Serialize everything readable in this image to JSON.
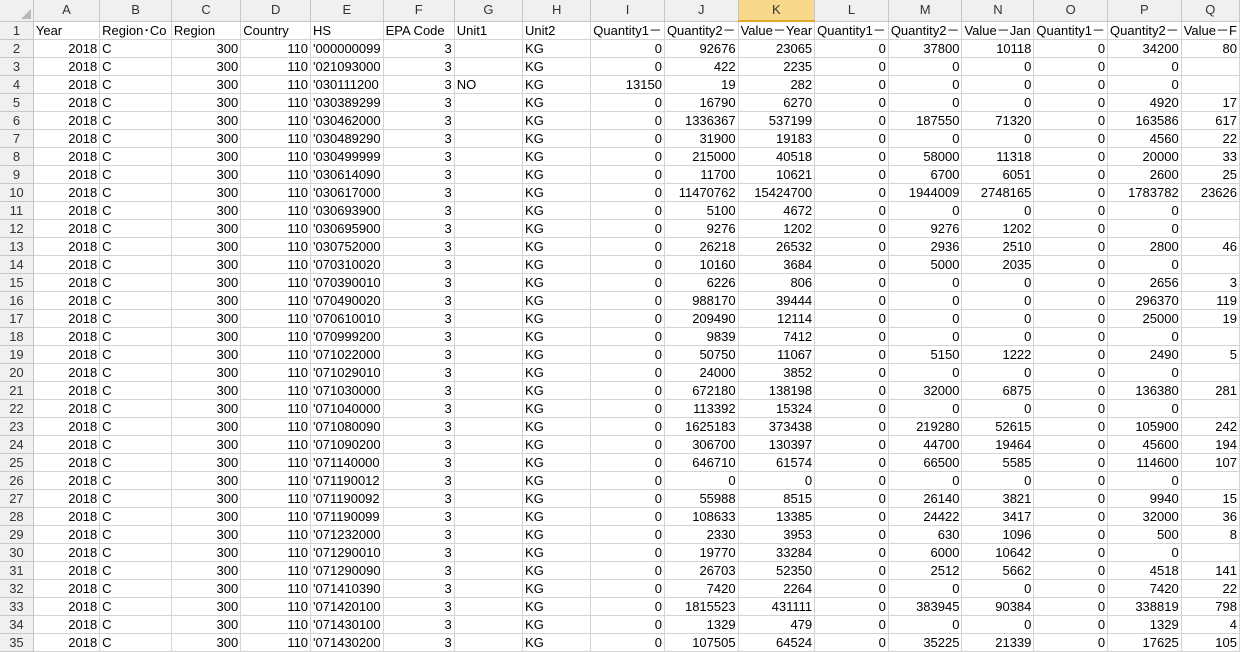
{
  "columns": [
    "A",
    "B",
    "C",
    "D",
    "E",
    "F",
    "G",
    "H",
    "I",
    "J",
    "K",
    "L",
    "M",
    "N",
    "O",
    "P",
    "Q"
  ],
  "selected_column": "K",
  "header_row": {
    "num": 1,
    "cells": [
      "Year",
      "Region･Co",
      "Region",
      "Country",
      "HS",
      "EPA Code",
      "Unit1",
      "Unit2",
      "Quantity1－",
      "Quantity2－",
      "Value－Year",
      "Quantity1－",
      "Quantity2－",
      "Value－Jan",
      "Quantity1－",
      "Quantity2－",
      "Value－F"
    ]
  },
  "rows": [
    {
      "num": 2,
      "hs": "'000000099",
      "unit1": "",
      "q1y": "0",
      "q2y": "92676",
      "vy": "23065",
      "q1j": "0",
      "q2j": "37800",
      "vj": "10118",
      "q1f": "0",
      "q2f": "34200",
      "vf": "80"
    },
    {
      "num": 3,
      "hs": "'021093000",
      "unit1": "",
      "q1y": "0",
      "q2y": "422",
      "vy": "2235",
      "q1j": "0",
      "q2j": "0",
      "vj": "0",
      "q1f": "0",
      "q2f": "0",
      "vf": ""
    },
    {
      "num": 4,
      "hs": "'030111200",
      "unit1": "NO",
      "q1y": "13150",
      "q2y": "19",
      "vy": "282",
      "q1j": "0",
      "q2j": "0",
      "vj": "0",
      "q1f": "0",
      "q2f": "0",
      "vf": ""
    },
    {
      "num": 5,
      "hs": "'030389299",
      "unit1": "",
      "q1y": "0",
      "q2y": "16790",
      "vy": "6270",
      "q1j": "0",
      "q2j": "0",
      "vj": "0",
      "q1f": "0",
      "q2f": "4920",
      "vf": "17"
    },
    {
      "num": 6,
      "hs": "'030462000",
      "unit1": "",
      "q1y": "0",
      "q2y": "1336367",
      "vy": "537199",
      "q1j": "0",
      "q2j": "187550",
      "vj": "71320",
      "q1f": "0",
      "q2f": "163586",
      "vf": "617"
    },
    {
      "num": 7,
      "hs": "'030489290",
      "unit1": "",
      "q1y": "0",
      "q2y": "31900",
      "vy": "19183",
      "q1j": "0",
      "q2j": "0",
      "vj": "0",
      "q1f": "0",
      "q2f": "4560",
      "vf": "22"
    },
    {
      "num": 8,
      "hs": "'030499999",
      "unit1": "",
      "q1y": "0",
      "q2y": "215000",
      "vy": "40518",
      "q1j": "0",
      "q2j": "58000",
      "vj": "11318",
      "q1f": "0",
      "q2f": "20000",
      "vf": "33"
    },
    {
      "num": 9,
      "hs": "'030614090",
      "unit1": "",
      "q1y": "0",
      "q2y": "11700",
      "vy": "10621",
      "q1j": "0",
      "q2j": "6700",
      "vj": "6051",
      "q1f": "0",
      "q2f": "2600",
      "vf": "25"
    },
    {
      "num": 10,
      "hs": "'030617000",
      "unit1": "",
      "q1y": "0",
      "q2y": "11470762",
      "vy": "15424700",
      "q1j": "0",
      "q2j": "1944009",
      "vj": "2748165",
      "q1f": "0",
      "q2f": "1783782",
      "vf": "23626"
    },
    {
      "num": 11,
      "hs": "'030693900",
      "unit1": "",
      "q1y": "0",
      "q2y": "5100",
      "vy": "4672",
      "q1j": "0",
      "q2j": "0",
      "vj": "0",
      "q1f": "0",
      "q2f": "0",
      "vf": ""
    },
    {
      "num": 12,
      "hs": "'030695900",
      "unit1": "",
      "q1y": "0",
      "q2y": "9276",
      "vy": "1202",
      "q1j": "0",
      "q2j": "9276",
      "vj": "1202",
      "q1f": "0",
      "q2f": "0",
      "vf": ""
    },
    {
      "num": 13,
      "hs": "'030752000",
      "unit1": "",
      "q1y": "0",
      "q2y": "26218",
      "vy": "26532",
      "q1j": "0",
      "q2j": "2936",
      "vj": "2510",
      "q1f": "0",
      "q2f": "2800",
      "vf": "46"
    },
    {
      "num": 14,
      "hs": "'070310020",
      "unit1": "",
      "q1y": "0",
      "q2y": "10160",
      "vy": "3684",
      "q1j": "0",
      "q2j": "5000",
      "vj": "2035",
      "q1f": "0",
      "q2f": "0",
      "vf": ""
    },
    {
      "num": 15,
      "hs": "'070390010",
      "unit1": "",
      "q1y": "0",
      "q2y": "6226",
      "vy": "806",
      "q1j": "0",
      "q2j": "0",
      "vj": "0",
      "q1f": "0",
      "q2f": "2656",
      "vf": "3"
    },
    {
      "num": 16,
      "hs": "'070490020",
      "unit1": "",
      "q1y": "0",
      "q2y": "988170",
      "vy": "39444",
      "q1j": "0",
      "q2j": "0",
      "vj": "0",
      "q1f": "0",
      "q2f": "296370",
      "vf": "119"
    },
    {
      "num": 17,
      "hs": "'070610010",
      "unit1": "",
      "q1y": "0",
      "q2y": "209490",
      "vy": "12114",
      "q1j": "0",
      "q2j": "0",
      "vj": "0",
      "q1f": "0",
      "q2f": "25000",
      "vf": "19"
    },
    {
      "num": 18,
      "hs": "'070999200",
      "unit1": "",
      "q1y": "0",
      "q2y": "9839",
      "vy": "7412",
      "q1j": "0",
      "q2j": "0",
      "vj": "0",
      "q1f": "0",
      "q2f": "0",
      "vf": ""
    },
    {
      "num": 19,
      "hs": "'071022000",
      "unit1": "",
      "q1y": "0",
      "q2y": "50750",
      "vy": "11067",
      "q1j": "0",
      "q2j": "5150",
      "vj": "1222",
      "q1f": "0",
      "q2f": "2490",
      "vf": "5"
    },
    {
      "num": 20,
      "hs": "'071029010",
      "unit1": "",
      "q1y": "0",
      "q2y": "24000",
      "vy": "3852",
      "q1j": "0",
      "q2j": "0",
      "vj": "0",
      "q1f": "0",
      "q2f": "0",
      "vf": ""
    },
    {
      "num": 21,
      "hs": "'071030000",
      "unit1": "",
      "q1y": "0",
      "q2y": "672180",
      "vy": "138198",
      "q1j": "0",
      "q2j": "32000",
      "vj": "6875",
      "q1f": "0",
      "q2f": "136380",
      "vf": "281"
    },
    {
      "num": 22,
      "hs": "'071040000",
      "unit1": "",
      "q1y": "0",
      "q2y": "113392",
      "vy": "15324",
      "q1j": "0",
      "q2j": "0",
      "vj": "0",
      "q1f": "0",
      "q2f": "0",
      "vf": ""
    },
    {
      "num": 23,
      "hs": "'071080090",
      "unit1": "",
      "q1y": "0",
      "q2y": "1625183",
      "vy": "373438",
      "q1j": "0",
      "q2j": "219280",
      "vj": "52615",
      "q1f": "0",
      "q2f": "105900",
      "vf": "242"
    },
    {
      "num": 24,
      "hs": "'071090200",
      "unit1": "",
      "q1y": "0",
      "q2y": "306700",
      "vy": "130397",
      "q1j": "0",
      "q2j": "44700",
      "vj": "19464",
      "q1f": "0",
      "q2f": "45600",
      "vf": "194"
    },
    {
      "num": 25,
      "hs": "'071140000",
      "unit1": "",
      "q1y": "0",
      "q2y": "646710",
      "vy": "61574",
      "q1j": "0",
      "q2j": "66500",
      "vj": "5585",
      "q1f": "0",
      "q2f": "114600",
      "vf": "107"
    },
    {
      "num": 26,
      "hs": "'071190012",
      "unit1": "",
      "q1y": "0",
      "q2y": "0",
      "vy": "0",
      "q1j": "0",
      "q2j": "0",
      "vj": "0",
      "q1f": "0",
      "q2f": "0",
      "vf": ""
    },
    {
      "num": 27,
      "hs": "'071190092",
      "unit1": "",
      "q1y": "0",
      "q2y": "55988",
      "vy": "8515",
      "q1j": "0",
      "q2j": "26140",
      "vj": "3821",
      "q1f": "0",
      "q2f": "9940",
      "vf": "15"
    },
    {
      "num": 28,
      "hs": "'071190099",
      "unit1": "",
      "q1y": "0",
      "q2y": "108633",
      "vy": "13385",
      "q1j": "0",
      "q2j": "24422",
      "vj": "3417",
      "q1f": "0",
      "q2f": "32000",
      "vf": "36"
    },
    {
      "num": 29,
      "hs": "'071232000",
      "unit1": "",
      "q1y": "0",
      "q2y": "2330",
      "vy": "3953",
      "q1j": "0",
      "q2j": "630",
      "vj": "1096",
      "q1f": "0",
      "q2f": "500",
      "vf": "8"
    },
    {
      "num": 30,
      "hs": "'071290010",
      "unit1": "",
      "q1y": "0",
      "q2y": "19770",
      "vy": "33284",
      "q1j": "0",
      "q2j": "6000",
      "vj": "10642",
      "q1f": "0",
      "q2f": "0",
      "vf": ""
    },
    {
      "num": 31,
      "hs": "'071290090",
      "unit1": "",
      "q1y": "0",
      "q2y": "26703",
      "vy": "52350",
      "q1j": "0",
      "q2j": "2512",
      "vj": "5662",
      "q1f": "0",
      "q2f": "4518",
      "vf": "141"
    },
    {
      "num": 32,
      "hs": "'071410390",
      "unit1": "",
      "q1y": "0",
      "q2y": "7420",
      "vy": "2264",
      "q1j": "0",
      "q2j": "0",
      "vj": "0",
      "q1f": "0",
      "q2f": "7420",
      "vf": "22"
    },
    {
      "num": 33,
      "hs": "'071420100",
      "unit1": "",
      "q1y": "0",
      "q2y": "1815523",
      "vy": "431111",
      "q1j": "0",
      "q2j": "383945",
      "vj": "90384",
      "q1f": "0",
      "q2f": "338819",
      "vf": "798"
    },
    {
      "num": 34,
      "hs": "'071430100",
      "unit1": "",
      "q1y": "0",
      "q2y": "1329",
      "vy": "479",
      "q1j": "0",
      "q2j": "0",
      "vj": "0",
      "q1f": "0",
      "q2f": "1329",
      "vf": "4"
    },
    {
      "num": 35,
      "hs": "'071430200",
      "unit1": "",
      "q1y": "0",
      "q2y": "107505",
      "vy": "64524",
      "q1j": "0",
      "q2j": "35225",
      "vj": "21339",
      "q1f": "0",
      "q2f": "17625",
      "vf": "105"
    }
  ],
  "common": {
    "year": "2018",
    "region_code": "C",
    "region": "300",
    "country": "110",
    "epa": "3",
    "unit2": "KG"
  }
}
